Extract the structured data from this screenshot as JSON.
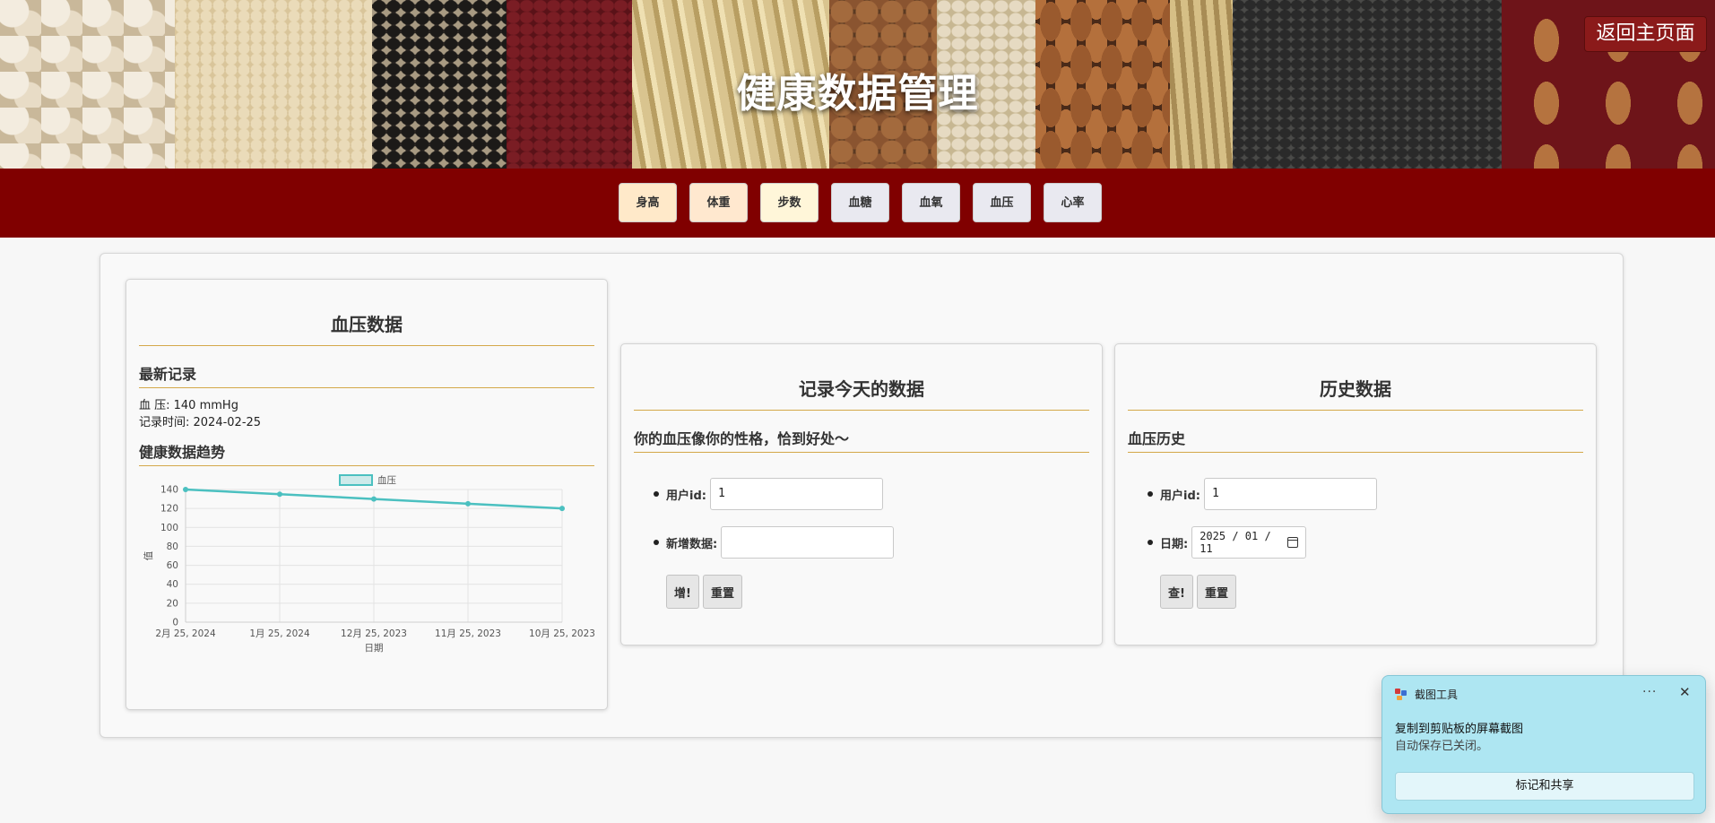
{
  "header": {
    "title": "健康数据管理",
    "back_button": "返回主页面"
  },
  "nav": {
    "items": [
      "身高",
      "体重",
      "步数",
      "血糖",
      "血氧",
      "血压",
      "心率"
    ]
  },
  "data_card": {
    "title": "血压数据",
    "latest_heading": "最新记录",
    "latest_value": "血  压: 140 mmHg",
    "latest_time": "记录时间: 2024-02-25",
    "trend_heading": "健康数据趋势"
  },
  "record_card": {
    "title": "记录今天的数据",
    "subtitle": "你的血压像你的性格，恰到好处～",
    "user_id_label": "用户id:",
    "user_id_value": "1",
    "new_data_label": "新增数据:",
    "new_data_value": "",
    "add_button": "增!",
    "reset_button": "重置"
  },
  "history_card": {
    "title": "历史数据",
    "subtitle": "血压历史",
    "user_id_label": "用户id:",
    "user_id_value": "1",
    "date_label": "日期:",
    "date_value": "2025 / 01 / 11",
    "query_button": "查!",
    "reset_button": "重置"
  },
  "chart_data": {
    "type": "line",
    "categories": [
      "2月 25, 2024",
      "1月 25, 2024",
      "12月 25, 2023",
      "11月 25, 2023",
      "10月 25, 2023"
    ],
    "series": [
      {
        "name": "血压",
        "values": [
          140,
          135,
          130,
          125,
          120
        ]
      }
    ],
    "xlabel": "日期",
    "ylabel": "值",
    "ylim": [
      0,
      140
    ],
    "yticks": [
      0,
      20,
      40,
      60,
      80,
      100,
      120,
      140
    ],
    "grid": true,
    "legend": "top",
    "color": "#4bc0c0"
  },
  "toast": {
    "app_name": "截图工具",
    "more": "···",
    "close": "✕",
    "message": "复制到剪贴板的屏幕截图",
    "sub_message": "自动保存已关闭。",
    "action": "标记和共享"
  }
}
